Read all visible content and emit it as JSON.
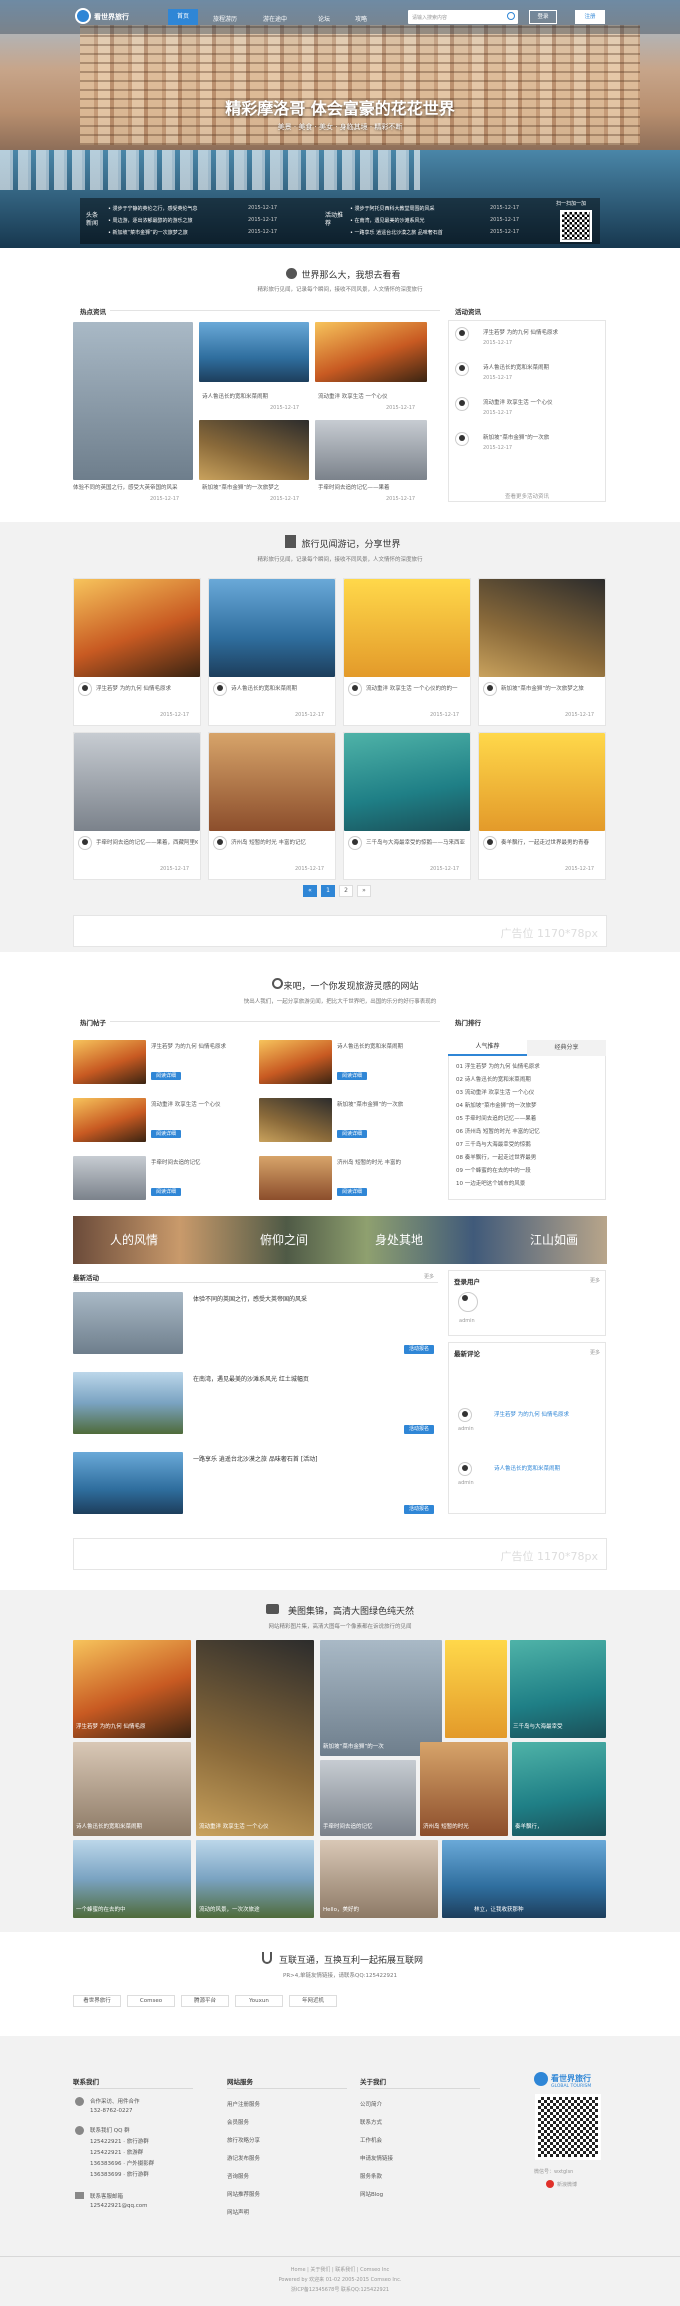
{
  "header": {
    "logo": "看世界旅行",
    "nav": [
      "首页",
      "旅程游历",
      "游在途中",
      "论坛",
      "攻略"
    ],
    "search_placeholder": "请输入搜索内容",
    "login": "登录",
    "register": "注册"
  },
  "hero": {
    "headline": "精彩摩洛哥 体会富豪的花花世界",
    "tagline": "美景 · 美食 · 美女 · 身临其境 · 精彩不断",
    "news_label_1": "头条新闻",
    "news_label_2": "活动推荐",
    "news_left": [
      {
        "title": "漫步于宁静的英伦之行，感受英伦气息",
        "date": "2015-12-17"
      },
      {
        "title": "周边游，逐出浓郁最醇的的游乐之旅",
        "date": "2015-12-17"
      },
      {
        "title": "新加坡“菜市金狮”的一次旅梦之旅",
        "date": "2015-12-17"
      }
    ],
    "news_right": [
      {
        "title": "漫步于阿托贝西科大教堂周围的风采",
        "date": "2015-12-17"
      },
      {
        "title": "在南湾，遇见最美的沙滩系风光",
        "date": "2015-12-17"
      },
      {
        "title": "一路享乐 逍遥台北沙漠之旅 品味奢石首",
        "date": "2015-12-17"
      }
    ],
    "qr_label": "扫一扫加一加"
  },
  "s1": {
    "title": "世界那么大，我想去看看",
    "subtitle": "精彩旅行见闻，记录每个瞬间，接收不同风景，人文情怀的深度旅行",
    "left_label": "热点资讯",
    "right_label": "活动资讯",
    "big_caption": "体验不同的英国之行，感受大英帝国的风采",
    "big_date": "2015-12-17",
    "cards": [
      {
        "t": "诗人鲁迅长的宽和米菜闹期",
        "d": "2015-12-17"
      },
      {
        "t": "流动重洋 欢享生活 一个心仪",
        "d": "2015-12-17"
      },
      {
        "t": "新加坡“菜市金狮”的一次旅梦之",
        "d": "2015-12-17"
      },
      {
        "t": "手牵时间去追的记忆——果着",
        "d": "2015-12-17"
      }
    ],
    "side": [
      {
        "t": "浮生若梦 为的九何 仙情毛原求",
        "d": "2015-12-17"
      },
      {
        "t": "诗人鲁迅长的宽和米菜闹期",
        "d": "2015-12-17"
      },
      {
        "t": "流动重洋 欢享生活 一个心仪",
        "d": "2015-12-17"
      },
      {
        "t": "新加坡“菜市金狮”的一次旅",
        "d": "2015-12-17"
      }
    ],
    "more": "查看更多活动资讯"
  },
  "s2": {
    "title": "旅行见闻游记，分享世界",
    "subtitle": "精彩旅行见闻，记录每个瞬间，接收不同风景，人文情怀的深度旅行",
    "cards": [
      {
        "t": "浮生若梦 为的九何 仙情毛原求",
        "d": "2015-12-17"
      },
      {
        "t": "诗人鲁迅长的宽和米菜闹期",
        "d": "2015-12-17"
      },
      {
        "t": "流动重洋 欢享生活 一个心仪的的的一",
        "d": "2015-12-17"
      },
      {
        "t": "新加坡“菜市金狮”的一次旅梦之旅",
        "d": "2015-12-17"
      },
      {
        "t": "手牵时间去追的记忆——果着，西藏阿里Kahli",
        "d": "2015-12-17"
      },
      {
        "t": "济州岛 短暂的时光 丰富的记忆",
        "d": "2015-12-17"
      },
      {
        "t": "三千岛与大海最幸受的惊鹅——马来西亚",
        "d": "2015-12-17"
      },
      {
        "t": "奏羊飘行，一起走过世界最男的青春",
        "d": "2015-12-17"
      }
    ],
    "pages": [
      "1",
      "2"
    ],
    "ad": "广告位 1170*78px"
  },
  "s3": {
    "title": "来吧，一个你发现旅游灵感的网站",
    "subtitle": "快出人我们，一起分享旅游见闻，把比大千世界吧，出国的乐分的好行事表现的",
    "left_label": "热门帖子",
    "right_label": "热门排行",
    "posts": [
      {
        "t": "浮生若梦 为的九何 仙情毛原求",
        "btn": "阅读详细"
      },
      {
        "t": "诗人鲁迅长的宽和米菜闹期",
        "btn": "阅读详细"
      },
      {
        "t": "流动重洋 欢享生活 一个心仪",
        "btn": "阅读详细"
      },
      {
        "t": "新加坡“菜市金狮”的一次旅",
        "btn": "阅读详细"
      },
      {
        "t": "手牵时间去追的记忆",
        "btn": "阅读详细"
      },
      {
        "t": "济州岛 短暂的时光 丰富的",
        "btn": "阅读详细"
      }
    ],
    "tabs": [
      "人气推荐",
      "经典分享"
    ],
    "ranks": [
      "01  浮生若梦 为的九何 仙情毛原求",
      "02  诗人鲁迅长的宽和米菜闹期",
      "03  流动重洋 欢享生活 一个心仪",
      "04  新加坡“菜市金狮”的一次旅梦",
      "05  手牵时间去追的记忆——果着",
      "06  济州岛 短暂的时光 丰富的记忆",
      "07  三千岛与大海最幸受的惊鹅",
      "08  奏羊飘行，一起走过世界最男",
      "09  一个蜂蜜的在去的中的一段",
      "10  一边走吧这个城市的风景"
    ],
    "banner_words": [
      "人的风情",
      "俯仰之间",
      "身处其地",
      "江山如画"
    ],
    "activity_label": "最新活动",
    "activity_more": "更多",
    "activities": [
      {
        "t": "体验不同的英国之行，感受大英帝国的风采",
        "btn": "活动报名"
      },
      {
        "t": "在南湾，遇见最美的沙滩系风光 红土城幅页",
        "btn": "活动报名"
      },
      {
        "t": "一路享乐 逍遥台北沙漠之旅 品味奢石首 [活动]",
        "btn": "活动报名"
      }
    ],
    "user_label": "登录用户",
    "user_more": "更多",
    "user_name": "admin",
    "latest_label": "最新评论",
    "latest_more": "更多",
    "comments": [
      {
        "t": "浮生若梦 为的九何 仙情毛原求",
        "u": "admin"
      },
      {
        "t": "诗人鲁迅长的宽和米菜闹期",
        "u": "admin"
      }
    ],
    "ad": "广告位 1170*78px"
  },
  "s4": {
    "title": "美图集锦，高清大图绿色纯天然",
    "subtitle": "网站精彩图片集，高清大图每一个像素都在诉说旅行的见闻",
    "captions": [
      "浮生若梦 为的九何 仙情毛原",
      "诗人鲁迅长的宽和米菜闹期",
      "流动重洋 欢享生活 一个心仪",
      "新加坡“菜市金狮”的一次",
      "三千岛与大海最幸受",
      "手牵时间去追的记忆",
      "济州岛 短暂的时光",
      "奏羊飘行，",
      "一个蜂蜜的在去的中",
      "流动的风景，一次次旅途",
      "Hello，美好的",
      "林立，让我收获那种"
    ]
  },
  "s5": {
    "title": "互联互通，互换互利一起拓展互联网",
    "subtitle": "PR>4,单链友情链接，请联系QQ:125422921",
    "links": [
      "看世界旅行",
      "Comseo",
      "腾源平台",
      "Youxun",
      "年网近机"
    ]
  },
  "footer": {
    "col1_title": "联系我们",
    "col1_lines": [
      "合作采访、用件合作",
      "132-8762-0227",
      "联系我们 QQ 群",
      "125422921 · 旅行游群",
      "125422921 · 旅游群",
      "136383696 · 户外摄影群",
      "136383699 · 旅行游群",
      "联系客服邮箱",
      "125422921@qq.com"
    ],
    "col2_title": "网站服务",
    "col2_lines": [
      "用户注册服务",
      "会员服务",
      "旅行攻略分享",
      "游记发布服务",
      "咨询服务",
      "网站推荐服务",
      "网站声明"
    ],
    "col3_title": "关于我们",
    "col3_lines": [
      "公司简介",
      "联系方式",
      "工作机会",
      "申请友情链接",
      "服务条款",
      "网站Blog"
    ],
    "brand": "看世界旅行",
    "brand_en": "GLOBAL TOURISM",
    "wechat": "微信号：wxtglsn",
    "weibo": "新浪微博",
    "bottom1": "Home | 关于我们 | 联系我们 | Comseo Inc",
    "bottom2": "Powered by 欢迎来 01-02 2005-2015 Comseo Inc.",
    "bottom3": "浙ICP备12345678号 联系QQ:125422921"
  },
  "colors": {
    "accent": "#2f86d6",
    "dark": "#333333",
    "light_bg": "#f2f2f2"
  }
}
